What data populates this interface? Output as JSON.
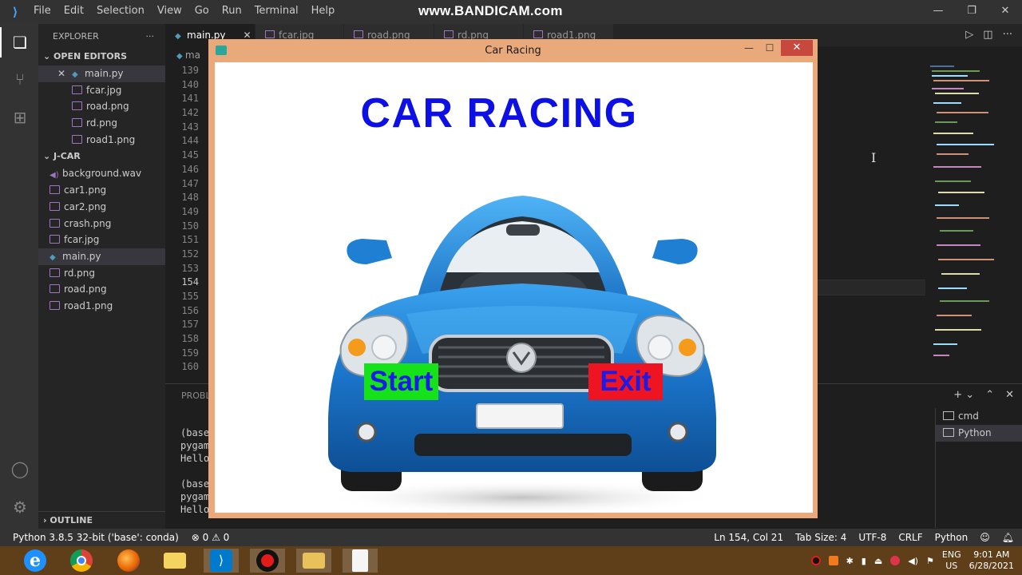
{
  "watermark": "www.BANDICAM.com",
  "vscode": {
    "menu": [
      "File",
      "Edit",
      "Selection",
      "View",
      "Go",
      "Run",
      "Terminal",
      "Help"
    ],
    "explorer_title": "EXPLORER",
    "explorer_more": "···",
    "open_editors_label": "OPEN EDITORS",
    "open_editors": [
      "main.py",
      "fcar.jpg",
      "road.png",
      "rd.png",
      "road1.png"
    ],
    "project_label": "J-CAR",
    "project_files": [
      "background.wav",
      "car1.png",
      "car2.png",
      "crash.png",
      "fcar.jpg",
      "main.py",
      "rd.png",
      "road.png",
      "road1.png"
    ],
    "outline_label": "OUTLINE",
    "tabs": [
      "main.py",
      "fcar.jpg",
      "road.png",
      "rd.png",
      "road1.png"
    ],
    "breadcrumb": "ma",
    "line_numbers": [
      "139",
      "140",
      "141",
      "142",
      "143",
      "144",
      "145",
      "146",
      "147",
      "148",
      "149",
      "150",
      "151",
      "152",
      "153",
      "154",
      "155",
      "156",
      "157",
      "158",
      "159",
      "160"
    ],
    "panel_tab": "PROBL",
    "terminal_lines": [
      "(base",
      "pygam",
      "Hello",
      "(base",
      "pygam",
      "Hello"
    ],
    "terminals": [
      "cmd",
      "Python"
    ],
    "status": {
      "interpreter": "Python 3.8.5 32-bit ('base': conda)",
      "problems": "⊗ 0 ⚠ 0",
      "position": "Ln 154, Col 21",
      "tab_size": "Tab Size: 4",
      "encoding": "UTF-8",
      "eol": "CRLF",
      "language": "Python"
    }
  },
  "game_window": {
    "caption": "Car Racing",
    "heading": "CAR RACING",
    "start_label": "Start",
    "exit_label": "Exit"
  },
  "taskbar": {
    "lang_line1": "ENG",
    "lang_line2": "US",
    "time": "9:01 AM",
    "date": "6/28/2021"
  }
}
